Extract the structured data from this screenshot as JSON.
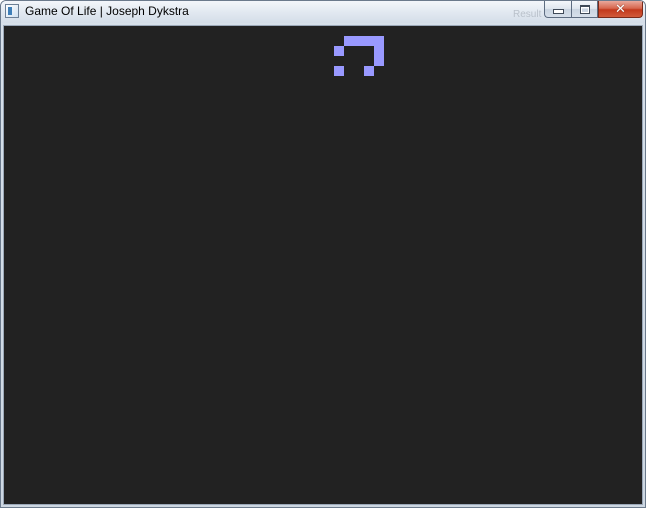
{
  "window": {
    "title": "Game Of Life | Joseph Dykstra",
    "background_title_fragment": "Result"
  },
  "caption_buttons": {
    "minimize_icon": "minimize-icon",
    "maximize_icon": "maximize-icon",
    "close_icon": "close-icon",
    "close_glyph": "✕"
  },
  "game": {
    "background_color": "#222222",
    "cell_color": "#9999ff",
    "cell_size": 10,
    "live_cells": [
      {
        "col": 34,
        "row": 1
      },
      {
        "col": 35,
        "row": 1
      },
      {
        "col": 36,
        "row": 1
      },
      {
        "col": 37,
        "row": 1
      },
      {
        "col": 33,
        "row": 2
      },
      {
        "col": 37,
        "row": 2
      },
      {
        "col": 37,
        "row": 3
      },
      {
        "col": 33,
        "row": 4
      },
      {
        "col": 36,
        "row": 4
      }
    ]
  }
}
